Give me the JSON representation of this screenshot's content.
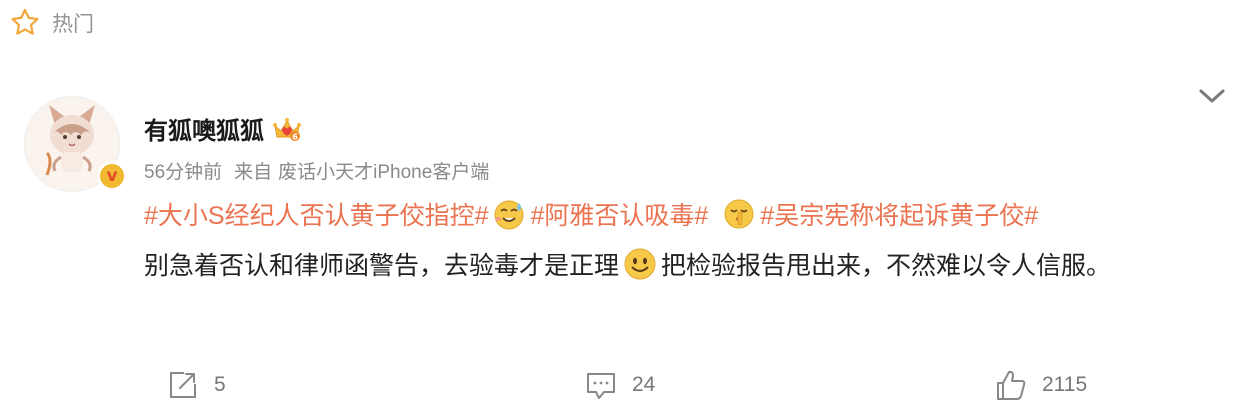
{
  "header": {
    "hot_label": "热门",
    "icon": "star-icon"
  },
  "post": {
    "username": "有狐噢狐狐",
    "badge_icon": "crown-level-6-icon",
    "verified_icon": "v-verified-icon",
    "time": "56分钟前",
    "source_prefix": "来自",
    "source": "废话小天才iPhone客户端",
    "tags": [
      "#大小S经纪人否认黄子佼指控#",
      "#阿雅否认吸毒#",
      "#吴宗宪称将起诉黄子佼#"
    ],
    "text_part1": "别急着否认和律师函警告，去验毒才是正理",
    "text_part2": "把检验报告甩出来，不然难以令人信服。"
  },
  "actions": {
    "repost_count": "5",
    "comment_count": "24",
    "like_count": "2115"
  },
  "colors": {
    "tag": "#eb7350",
    "meta": "#8a8a8a",
    "badge": "#f0b92f"
  }
}
